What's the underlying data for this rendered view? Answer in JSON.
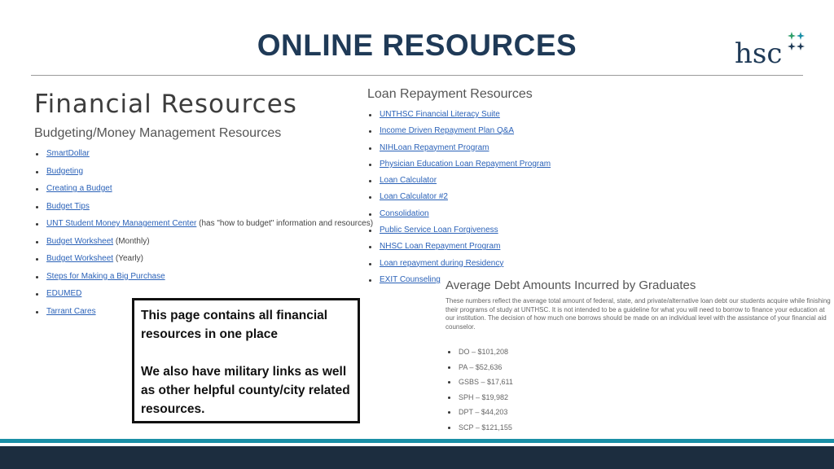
{
  "slide": {
    "title": "ONLINE RESOURCES"
  },
  "logo": {
    "text": "hsc"
  },
  "financial": {
    "heading": "Financial Resources",
    "budgeting_heading": "Budgeting/Money Management Resources",
    "items": [
      {
        "link": "SmartDollar",
        "suffix": ""
      },
      {
        "link": "Budgeting",
        "suffix": ""
      },
      {
        "link": "Creating a Budget",
        "suffix": ""
      },
      {
        "link": "Budget Tips",
        "suffix": ""
      },
      {
        "link": "UNT Student Money Management Center",
        "suffix": " (has \"how to budget\" information and resources)"
      },
      {
        "link": "Budget Worksheet",
        "suffix": " (Monthly)"
      },
      {
        "link": "Budget Worksheet",
        "suffix": " (Yearly)"
      },
      {
        "link": "Steps for Making a Big Purchase",
        "suffix": ""
      },
      {
        "link": "EDUMED",
        "suffix": ""
      },
      {
        "link": "Tarrant Cares",
        "suffix": ""
      }
    ]
  },
  "loan": {
    "heading": "Loan Repayment Resources",
    "items": [
      "UNTHSC Financial Literacy Suite",
      "Income Driven Repayment Plan Q&A",
      "NIHLoan Repayment Program",
      "Physician Education Loan Repayment Program",
      "Loan Calculator",
      "Loan Calculator #2",
      "Consolidation",
      "Public Service Loan Forgiveness",
      "NHSC Loan Repayment Program",
      "Loan repayment during Residency",
      "EXIT Counseling"
    ]
  },
  "debt": {
    "heading": "Average Debt Amounts Incurred by Graduates",
    "paragraph": "These numbers reflect the average total amount of federal, state, and private/alternative loan debt our students acquire while finishing their programs of study at UNTHSC. It is not intended to be a guideline for what you will need to borrow to finance your education at our institution. The decision of how much one borrows should be made on an individual level with the assistance of your financial aid counselor.",
    "items": [
      "DO – $101,208",
      "PA – $52,636",
      "GSBS – $17,611",
      "SPH – $19,982",
      "DPT – $44,203",
      "SCP – $121,155"
    ]
  },
  "callout": {
    "line1": "This page contains all financial resources in one place",
    "line2": "We also have military links as well as other helpful county/city related resources."
  },
  "colors": {
    "title": "#1f3a57",
    "link": "#2b62b8",
    "teal": "#1a8fa6",
    "footer": "#1c2d3f",
    "star_green": "#2e9e6a",
    "star_blue": "#1f3a57"
  }
}
